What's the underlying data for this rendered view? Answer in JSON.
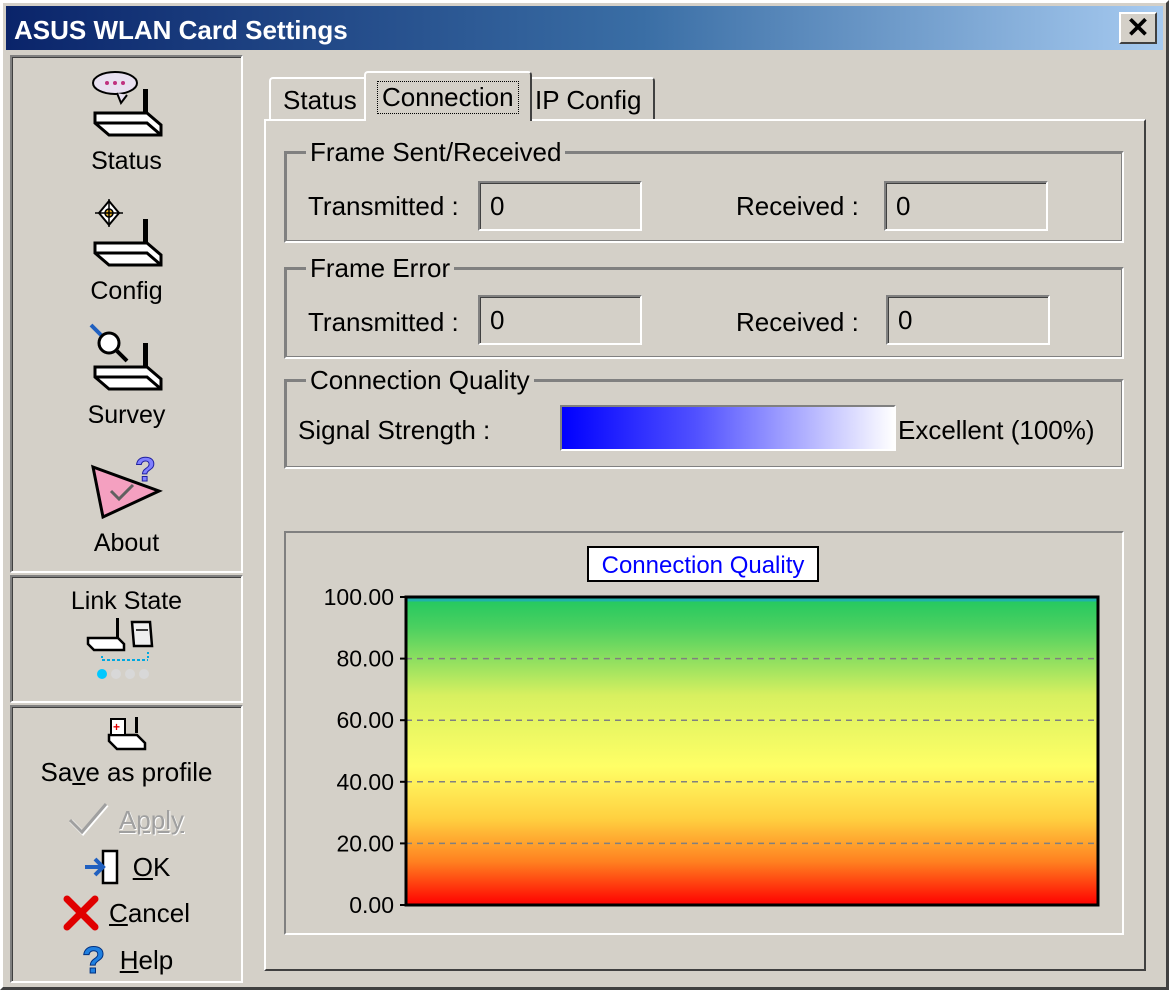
{
  "window": {
    "title": "ASUS WLAN Card Settings",
    "close_label": "✕"
  },
  "sidebar": {
    "items": [
      {
        "label": "Status",
        "icon": "router-chat-icon"
      },
      {
        "label": "Config",
        "icon": "router-config-icon"
      },
      {
        "label": "Survey",
        "icon": "router-survey-icon"
      },
      {
        "label": "About",
        "icon": "about-help-icon"
      }
    ],
    "link_state": {
      "label": "Link State",
      "icon": "link-state-icon"
    },
    "actions": {
      "save_profile": {
        "pre": "Sa",
        "ul": "v",
        "post": "e as profile",
        "icon": "save-profile-icon"
      },
      "apply": {
        "label": "Apply",
        "icon": "checkmark-icon",
        "disabled": true
      },
      "ok": {
        "ul": "O",
        "post": "K",
        "icon": "exit-door-icon"
      },
      "cancel": {
        "ul": "C",
        "post": "ancel",
        "icon": "red-x-icon"
      },
      "help": {
        "ul": "H",
        "post": "elp",
        "icon": "question-mark-icon"
      }
    }
  },
  "tabs": [
    {
      "label": "Status",
      "active": false
    },
    {
      "label": "Connection",
      "active": true
    },
    {
      "label": "IP Config",
      "active": false
    }
  ],
  "frame_sent_received": {
    "title": "Frame Sent/Received",
    "transmitted_label": "Transmitted :",
    "transmitted_value": "0",
    "received_label": "Received :",
    "received_value": "0"
  },
  "frame_error": {
    "title": "Frame Error",
    "transmitted_label": "Transmitted :",
    "transmitted_value": "0",
    "received_label": "Received :",
    "received_value": "0"
  },
  "connection_quality": {
    "title": "Connection Quality",
    "signal_label": "Signal Strength :",
    "signal_text": "Excellent (100%)",
    "signal_percent": 100
  },
  "chart_data": {
    "type": "area",
    "title": "Connection Quality",
    "ylim": [
      0,
      100
    ],
    "yticks": [
      "100.00",
      "80.00",
      "60.00",
      "40.00",
      "20.00",
      "0.00"
    ],
    "ytick_values": [
      100,
      80,
      60,
      40,
      20,
      0
    ],
    "values": [
      100,
      100,
      100,
      100,
      100,
      100,
      100,
      100,
      100,
      100
    ],
    "grid": true,
    "colors": {
      "top": "#2ecc71",
      "mid": "#ffff66",
      "bottom": "#ff0000",
      "line": "#20b2aa"
    }
  }
}
